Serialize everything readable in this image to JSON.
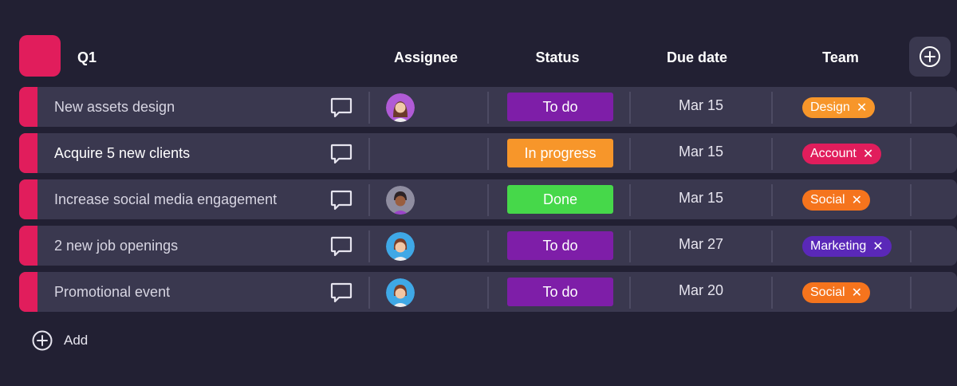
{
  "group": {
    "title": "Q1",
    "color": "#e11d5c"
  },
  "columns": {
    "assignee": "Assignee",
    "status": "Status",
    "due": "Due date",
    "team": "Team"
  },
  "rows": [
    {
      "name": "New assets design",
      "assignee": "avatar-woman",
      "status": "To do",
      "status_color": "#7e1ea8",
      "due": "Mar 15",
      "team": "Design",
      "team_color": "#f7962a"
    },
    {
      "name": "Acquire 5 new clients",
      "assignee": "",
      "status": "In progress",
      "status_color": "#f7962a",
      "due": "Mar 15",
      "team": "Account",
      "team_color": "#e11d5c"
    },
    {
      "name": "Increase social media engagement",
      "assignee": "avatar-man",
      "status": "Done",
      "status_color": "#46d84a",
      "due": "Mar 15",
      "team": "Social",
      "team_color": "#f5741d"
    },
    {
      "name": "2 new job openings",
      "assignee": "avatar-woman-blue",
      "status": "To do",
      "status_color": "#7e1ea8",
      "due": "Mar 27",
      "team": "Marketing",
      "team_color": "#5a28b8"
    },
    {
      "name": "Promotional event",
      "assignee": "avatar-woman-blue",
      "status": "To do",
      "status_color": "#7e1ea8",
      "due": "Mar 20",
      "team": "Social",
      "team_color": "#f5741d"
    }
  ],
  "tag_remove_glyph": "✕",
  "add_label": "Add"
}
